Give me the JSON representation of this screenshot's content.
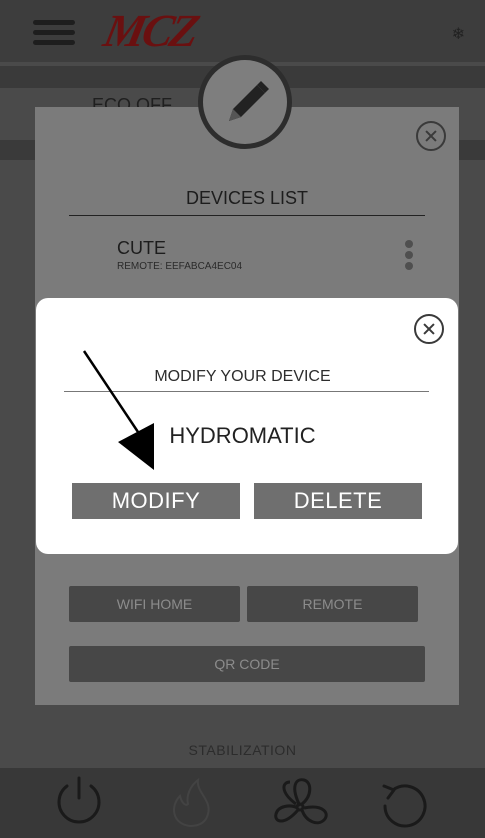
{
  "header": {
    "logo_text": "MCZ",
    "menu_icon": "hamburger-icon",
    "snow_icon": "snowflake-icon"
  },
  "background": {
    "faded_row": "ECO OFF",
    "status_label": "STABILIZATION"
  },
  "devices_panel": {
    "title": "DEVICES LIST",
    "devices": [
      {
        "name": "CUTE",
        "subtitle": "REMOTE: EEFABCA4EC04"
      }
    ],
    "buttons": {
      "wifi_home": "WIFI HOME",
      "remote": "REMOTE",
      "qr_code": "QR CODE"
    }
  },
  "modify_dialog": {
    "title": "MODIFY YOUR DEVICE",
    "device_name": "HYDROMATIC",
    "modify_label": "MODIFY",
    "delete_label": "DELETE"
  },
  "bottom_bar": {
    "icons": [
      "power-icon",
      "flame-icon",
      "fan-icon",
      "reset-icon"
    ]
  },
  "colors": {
    "dialog_bg": "#ffffff",
    "button_gray": "#6f6f6f",
    "panel_gray": "#7b7b7b",
    "logo_red": "#6a1010"
  }
}
